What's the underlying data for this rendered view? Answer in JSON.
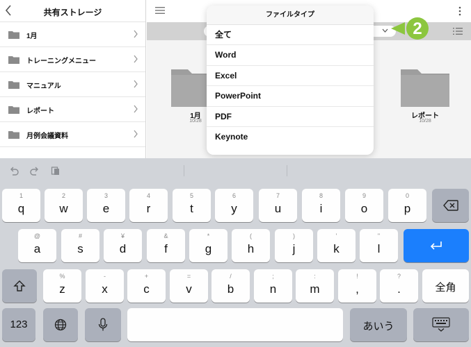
{
  "sidebar": {
    "title": "共有ストレージ",
    "items": [
      {
        "label": "1月"
      },
      {
        "label": "トレーニングメニュー"
      },
      {
        "label": "マニュアル"
      },
      {
        "label": "レポート"
      },
      {
        "label": "月例会議資料"
      }
    ]
  },
  "main": {
    "folders": [
      {
        "name": "1月",
        "date": "10/28"
      },
      {
        "name": "レポート",
        "date": "10/28"
      }
    ],
    "callout_number": "2"
  },
  "popover": {
    "title": "ファイルタイプ",
    "items": [
      {
        "label": "全て"
      },
      {
        "label": "Word"
      },
      {
        "label": "Excel"
      },
      {
        "label": "PowerPoint"
      },
      {
        "label": "PDF"
      },
      {
        "label": "Keynote"
      }
    ]
  },
  "keyboard": {
    "row1": [
      {
        "sub": "1",
        "main": "q"
      },
      {
        "sub": "2",
        "main": "w"
      },
      {
        "sub": "3",
        "main": "e"
      },
      {
        "sub": "4",
        "main": "r"
      },
      {
        "sub": "5",
        "main": "t"
      },
      {
        "sub": "6",
        "main": "y"
      },
      {
        "sub": "7",
        "main": "u"
      },
      {
        "sub": "8",
        "main": "i"
      },
      {
        "sub": "9",
        "main": "o"
      },
      {
        "sub": "0",
        "main": "p"
      }
    ],
    "row2": [
      {
        "sub": "@",
        "main": "a"
      },
      {
        "sub": "#",
        "main": "s"
      },
      {
        "sub": "¥",
        "main": "d"
      },
      {
        "sub": "&",
        "main": "f"
      },
      {
        "sub": "*",
        "main": "g"
      },
      {
        "sub": "(",
        "main": "h"
      },
      {
        "sub": ")",
        "main": "j"
      },
      {
        "sub": "'",
        "main": "k"
      },
      {
        "sub": "\"",
        "main": "l"
      }
    ],
    "row3": [
      {
        "sub": "%",
        "main": "z"
      },
      {
        "sub": "-",
        "main": "x"
      },
      {
        "sub": "+",
        "main": "c"
      },
      {
        "sub": "=",
        "main": "v"
      },
      {
        "sub": "/",
        "main": "b"
      },
      {
        "sub": ";",
        "main": "n"
      },
      {
        "sub": ":",
        "main": "m"
      },
      {
        "sub": "!",
        "main": ","
      },
      {
        "sub": "?",
        "main": "."
      }
    ],
    "zenkaku_label": "全角",
    "numbers_label": "123",
    "kana_label": "あいう",
    "colors": {
      "return_key": "#1b7ffd",
      "callout": "#8cc63f"
    }
  }
}
